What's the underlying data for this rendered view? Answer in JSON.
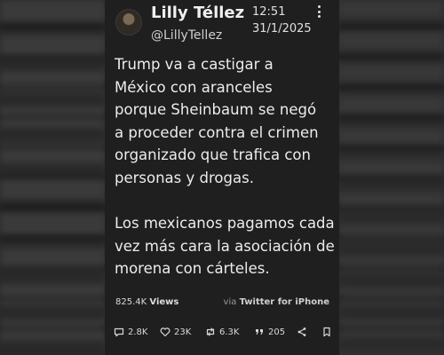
{
  "tweet": {
    "author_name": "Lilly Téllez",
    "handle": "@LillyTellez",
    "time": "12:51",
    "date": "31/1/2025",
    "text": "Trump va a castigar a\nMéxico con aranceles\nporque Sheinbaum se negó\na proceder contra el crimen\norganizado que trafica con\npersonas y drogas.\n\nLos mexicanos pagamos cada\nvez más cara la asociación de\nmorena con cárteles.",
    "views_count": "825.4K",
    "views_label": "Views",
    "via_prefix": "via",
    "via_source": "Twitter for iPhone",
    "replies": "2.8K",
    "likes": "23K",
    "retweets": "6.3K",
    "quotes": "205"
  },
  "icons": {
    "reply": "reply-icon",
    "like": "heart-icon",
    "retweet": "retweet-icon",
    "quote": "quote-icon",
    "share": "share-icon",
    "bookmark": "bookmark-icon",
    "more": "more-vertical-icon"
  }
}
